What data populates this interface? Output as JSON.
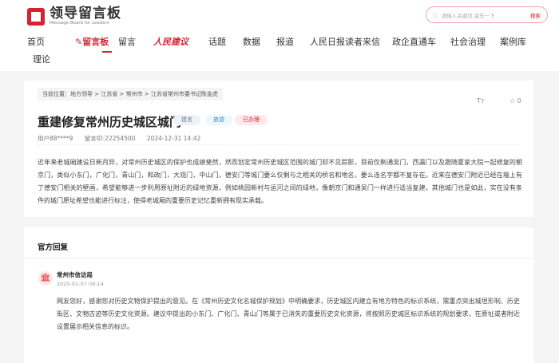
{
  "header": {
    "logo_title": "领导留言板",
    "logo_sub": "Message Board for Leaders",
    "search_placeholder": "请输入关键词 留车一下",
    "search_button": "搜索"
  },
  "nav": [
    "首页",
    "留言板",
    "留言",
    "人民建议",
    "话题",
    "数据",
    "报道",
    "人民日报读者来信",
    "政企直通车",
    "社会治理",
    "案例库",
    "理论"
  ],
  "article": {
    "breadcrumb": "当前位置：地方领导 > 江苏省 > 常州市 > 江苏省常州市委书记陈金虎",
    "title": "重建修复常州历史城区城门",
    "tags": [
      "建言",
      "旅游",
      "已办理"
    ],
    "user": "用户88****9",
    "id": "留言ID:22254500",
    "date": "2024-12-31 14:42",
    "font_icon": "Tт",
    "star_count": "0",
    "body": "近年来老城厢建设日新月异，对常州历史城区的保护也成绩斐然，然而划定常州历史城区范围的城门却不见踪影，目前仅剩通吴门，西瀛门以及跟随夏家大院一起修复的朝京门，类似小东门，广化门，青山门，和政门，大观门，中山门，德安门等城门要么仅剩与之相关的桥名和地名，要么连名字都不复存在。近来在德安门附近已经在墙上有了德安门相关的壁画，希望能够进一步利用原址附近的绿地资源，例如桃园新村与运河之间的绿地，像朝京门和通吴门一样进行适当复建，其他城门也是如此，实在没有条件的城门原址希望也能进行标注，使得老城厢的重要历史记忆重新拥有现实承载。"
  },
  "reply": {
    "section_title": "官方回复",
    "org": "常州市信访局",
    "date": "2025-01-07 09:14",
    "body": "网友您好，感谢您对历史文物保护提出的意见。在《常州历史文化名城保护规划》中明确要求，历史城区内建立有地方特色的标识系统，需重点突出城垣形制、历史街区、文物古迹等历史文化资源。建议中提出的小东门、广化门、青山门等属于已消失的重要历史文化资源，将按照历史城区标识系统的规划要求，在原址或者附近设置展示相关信息的标识。"
  },
  "colors": {
    "brand": "#d7232e"
  }
}
